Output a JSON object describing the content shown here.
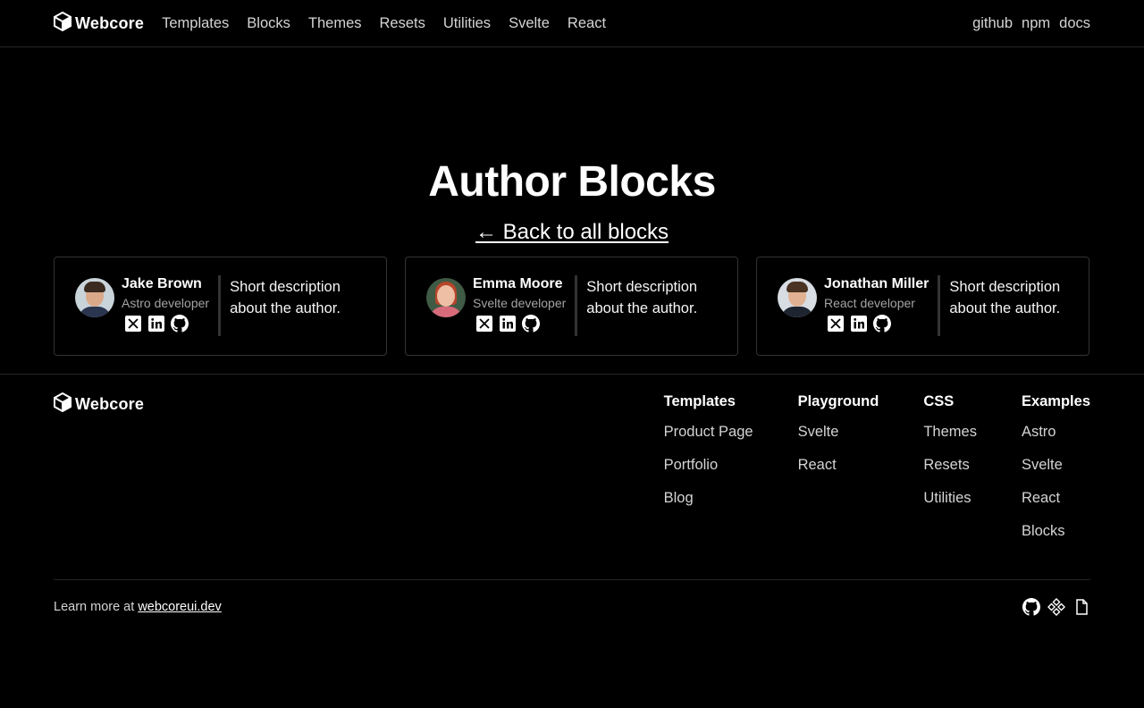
{
  "header": {
    "brand": "Webcore",
    "nav": [
      "Templates",
      "Blocks",
      "Themes",
      "Resets",
      "Utilities",
      "Svelte",
      "React"
    ],
    "right_links": [
      "github",
      "npm",
      "docs"
    ]
  },
  "hero": {
    "title": "Author Blocks",
    "back_link": "← Back to all blocks"
  },
  "authors": [
    {
      "name": "Jake Brown",
      "role": "Astro developer",
      "description": "Short description about the author.",
      "social_icons": [
        "x-icon",
        "linkedin-icon",
        "github-icon"
      ]
    },
    {
      "name": "Emma Moore",
      "role": "Svelte developer",
      "description": "Short description about the author.",
      "social_icons": [
        "x-icon",
        "linkedin-icon",
        "github-icon"
      ]
    },
    {
      "name": "Jonathan Miller",
      "role": "React developer",
      "description": "Short description about the author.",
      "social_icons": [
        "x-icon",
        "linkedin-icon",
        "github-icon"
      ]
    }
  ],
  "footer": {
    "brand": "Webcore",
    "columns": [
      {
        "title": "Templates",
        "links": [
          "Product Page",
          "Portfolio",
          "Blog"
        ]
      },
      {
        "title": "Playground",
        "links": [
          "Svelte",
          "React"
        ]
      },
      {
        "title": "CSS",
        "links": [
          "Themes",
          "Resets",
          "Utilities"
        ]
      },
      {
        "title": "Examples",
        "links": [
          "Astro",
          "Svelte",
          "React",
          "Blocks"
        ]
      }
    ],
    "learn_text": "Learn more at",
    "learn_link": "webcoreui.dev",
    "icons": [
      "github-icon",
      "npm-icon",
      "docs-icon"
    ]
  },
  "colors": {
    "background": "#000000",
    "text": "#ffffff",
    "muted": "#a3a3a3",
    "border": "#333333"
  }
}
